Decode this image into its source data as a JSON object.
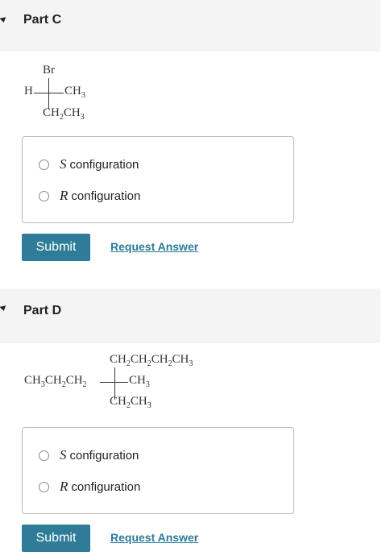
{
  "parts": [
    {
      "title": "Part C",
      "structure": {
        "top": "Br",
        "left": "H",
        "right": {
          "base": "CH",
          "sub": "3"
        },
        "bottom": {
          "a": "CH",
          "a_sub": "2",
          "b": "CH",
          "b_sub": "3"
        }
      },
      "options": [
        {
          "letter": "S",
          "text": "configuration"
        },
        {
          "letter": "R",
          "text": "configuration"
        }
      ],
      "submit_label": "Submit",
      "request_answer_label": "Request Answer"
    },
    {
      "title": "Part D",
      "structure": {
        "top": {
          "a": "CH",
          "a_sub": "2",
          "b": "CH",
          "b_sub": "2",
          "c": "CH",
          "c_sub": "2",
          "d": "CH",
          "d_sub": "3"
        },
        "left": {
          "a": "CH",
          "a_sub": "3",
          "b": "CH",
          "b_sub": "2",
          "c": "CH",
          "c_sub": "2"
        },
        "right": {
          "base": "CH",
          "sub": "3"
        },
        "bottom": {
          "a": "CH",
          "a_sub": "2",
          "b": "CH",
          "b_sub": "3"
        }
      },
      "options": [
        {
          "letter": "S",
          "text": "configuration"
        },
        {
          "letter": "R",
          "text": "configuration"
        }
      ],
      "submit_label": "Submit",
      "request_answer_label": "Request Answer"
    }
  ],
  "colors": {
    "header_bg": "#f4f4f4",
    "submit_bg": "#2f7c98",
    "link": "#2a7a9a",
    "box_border": "#b9b9b9"
  },
  "icons": {
    "collapse": "caret-down-icon",
    "radio": "radio-unchecked-icon"
  }
}
